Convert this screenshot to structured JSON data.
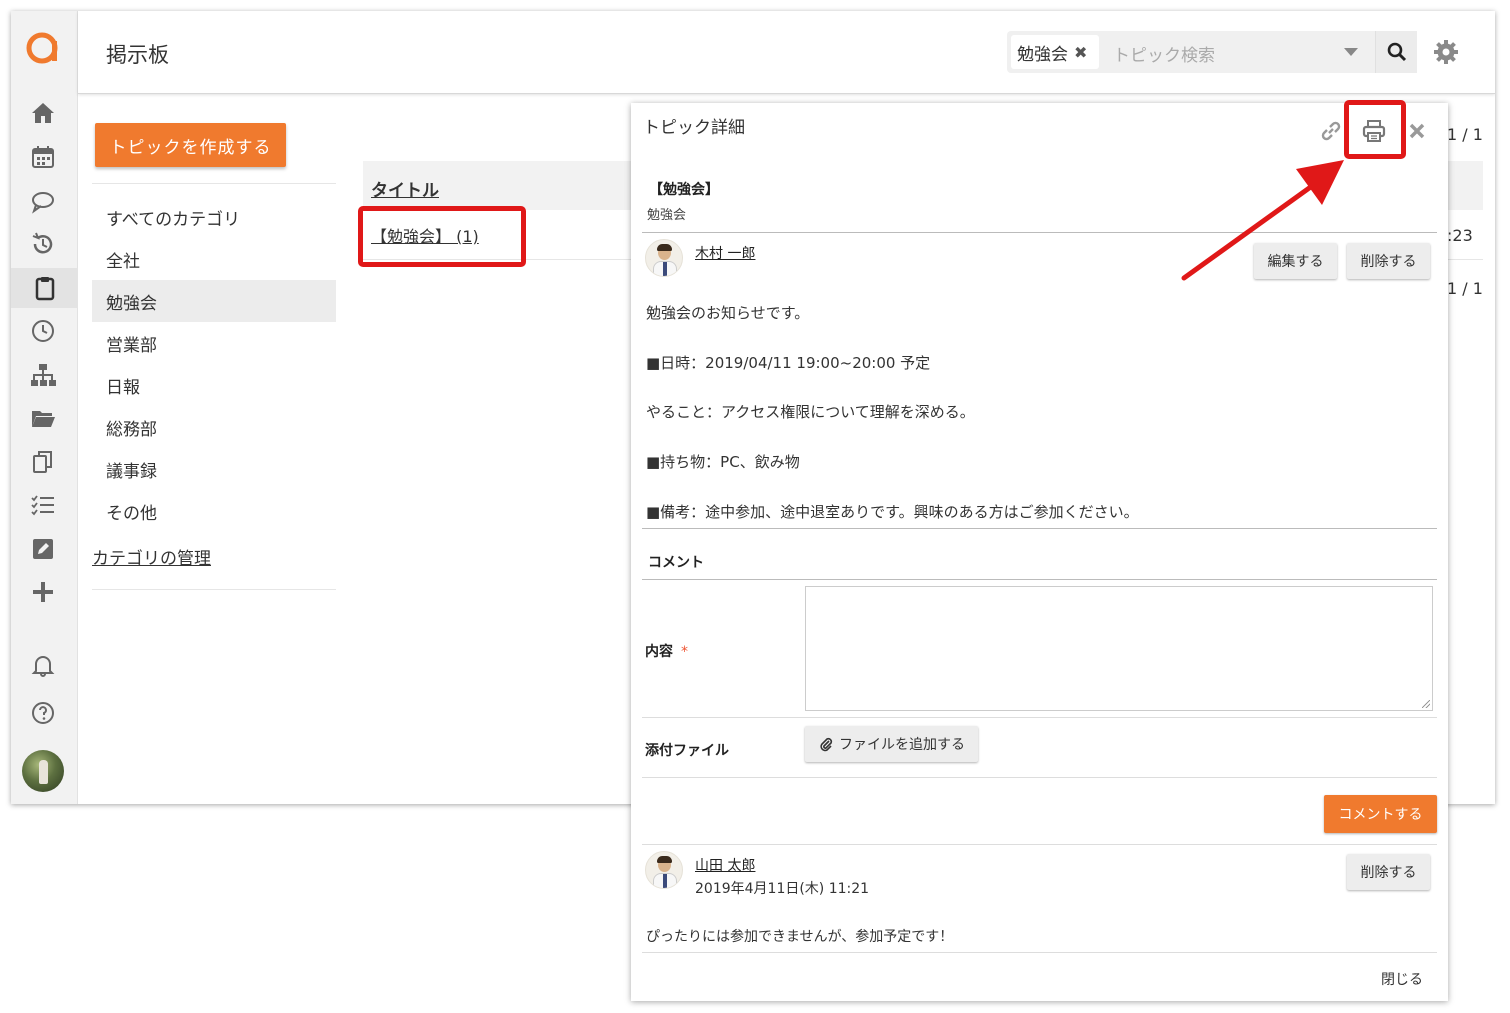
{
  "app": {
    "page_title": "掲示板",
    "search": {
      "chip_label": "勉強会",
      "placeholder": "トピック検索"
    }
  },
  "sidebar_icons": [
    "home-icon",
    "calendar-icon",
    "chat-icon",
    "history-icon",
    "clipboard-icon",
    "clock-icon",
    "org-chart-icon",
    "folder-icon",
    "copy-icon",
    "task-list-icon",
    "edit-icon",
    "plus-icon",
    "bell-icon",
    "help-icon"
  ],
  "board": {
    "create_button": "トピックを作成する",
    "categories": [
      "すべてのカテゴリ",
      "全社",
      "勉強会",
      "営業部",
      "日報",
      "総務部",
      "議事録",
      "その他"
    ],
    "active_category": "勉強会",
    "manage_link": "カテゴリの管理",
    "column_title": "タイトル",
    "row_link": "【勉強会】 (1)",
    "pager_top": "1 / 1",
    "row_time": ":23",
    "pager_bottom": "1 / 1"
  },
  "topic": {
    "modal_title": "トピック詳細",
    "category_label": "【勉強会】",
    "sub_label": "勉強会",
    "author": "木村 一郎",
    "edit_button": "編集する",
    "delete_button": "削除する",
    "lines": [
      "勉強会のお知らせです。",
      "■日時：2019/04/11 19:00~20:00 予定",
      "やること：アクセス権限について理解を深める。",
      "■持ち物：PC、飲み物",
      "■備考：途中参加、途中退室ありです。興味のある方はご参加ください。"
    ]
  },
  "comment_form": {
    "section_title": "コメント",
    "content_label": "内容",
    "required_mark": "*",
    "attach_label": "添付ファイル",
    "attach_button": "ファイルを追加する",
    "submit_button": "コメントする"
  },
  "comment": {
    "author": "山田 太郎",
    "date": "2019年4月11日(木) 11:21",
    "delete_button": "削除する",
    "text": "ぴったりには参加できませんが、参加予定です！"
  },
  "close_label": "閉じる",
  "colors": {
    "accent": "#f07a2e",
    "annotation": "#e01818"
  }
}
